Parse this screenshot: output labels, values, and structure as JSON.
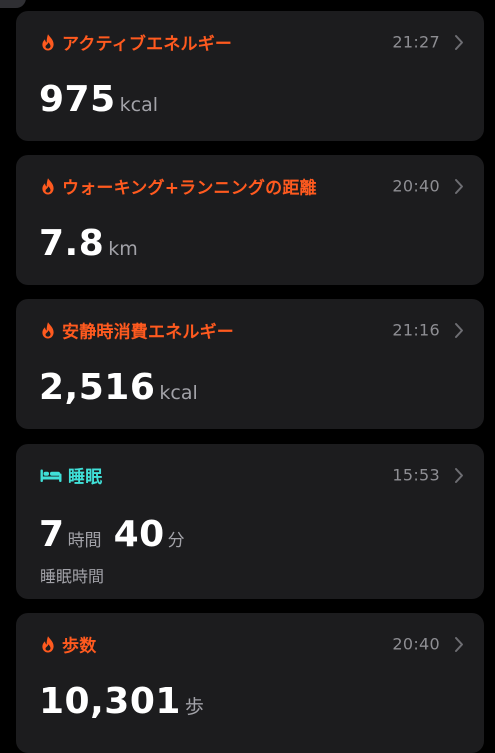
{
  "colors": {
    "activity_accent": "#ff5a1f",
    "sleep_accent": "#40e0d8",
    "card_background": "#1c1c1e",
    "secondary_text": "#8e8e93"
  },
  "cards": [
    {
      "icon": "flame-icon",
      "title": "アクティブエネルギー",
      "time": "21:27",
      "value": "975",
      "unit": "kcal"
    },
    {
      "icon": "flame-icon",
      "title": "ウォーキング+ランニングの距離",
      "time": "20:40",
      "value": "7.8",
      "unit": "km"
    },
    {
      "icon": "flame-icon",
      "title": "安静時消費エネルギー",
      "time": "21:16",
      "value": "2,516",
      "unit": "kcal"
    },
    {
      "icon": "bed-icon",
      "title": "睡眠",
      "time": "15:53",
      "hours": "7",
      "hours_unit": "時間",
      "minutes": "40",
      "minutes_unit": "分",
      "sub_label": "睡眠時間"
    },
    {
      "icon": "flame-icon",
      "title": "歩数",
      "time": "20:40",
      "value": "10,301",
      "unit": "歩"
    }
  ]
}
